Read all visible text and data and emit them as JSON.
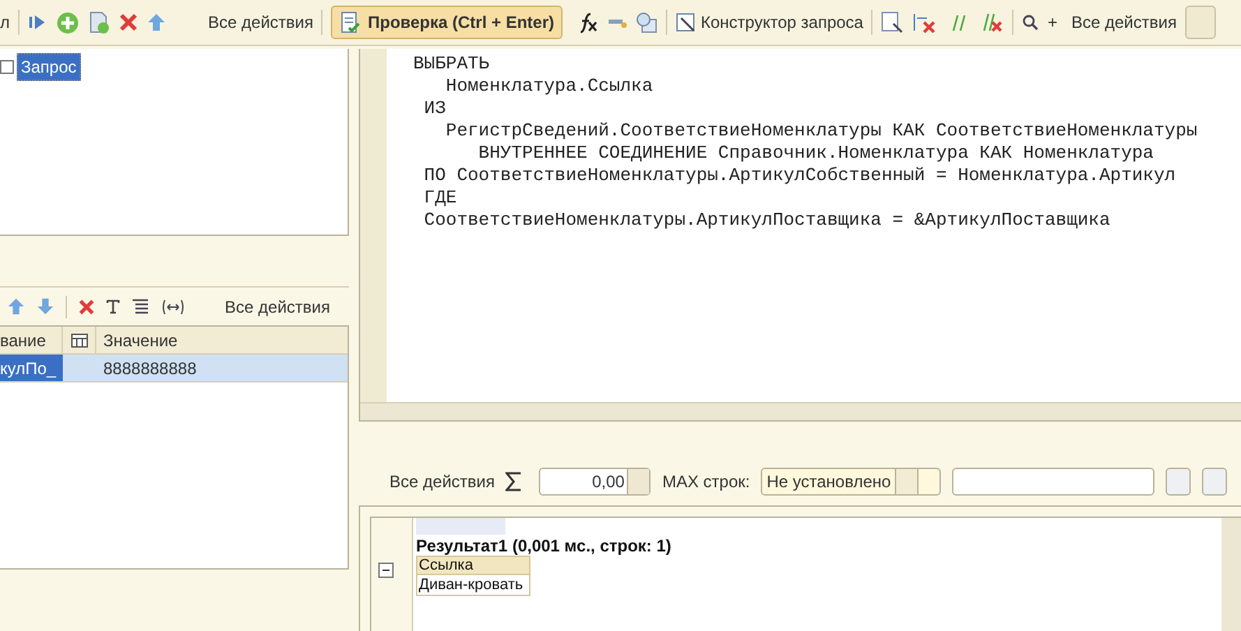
{
  "main_toolbar": {
    "cut_label": "л",
    "actions_menu": "Все действия",
    "check_button": "Проверка (Ctrl + Enter)",
    "constructor_button": "Конструктор запроса",
    "zoom_label": "+",
    "actions_menu_2": "Все действия"
  },
  "query_tree": {
    "items": [
      {
        "label": "Запрос",
        "checked": false,
        "selected": true
      }
    ]
  },
  "parameters": {
    "actions_menu": "Все действия",
    "columns": [
      "вание",
      "Значение"
    ],
    "rows": [
      {
        "name": "кулПо_",
        "value": "8888888888",
        "selected": true
      }
    ]
  },
  "query_text": [
    "ВЫБРАТЬ",
    "   Номенклатура.Ссылка",
    " ИЗ",
    "   РегистрСведений.СоответствиеНоменклатуры КАК СоответствиеНоменклатуры",
    "      ВНУТРЕННЕЕ СОЕДИНЕНИЕ Справочник.Номенклатура КАК Номенклатура",
    " ПО СоответствиеНоменклатуры.АртикулСобственный = Номенклатура.Артикул",
    " ГДЕ",
    " СоответствиеНоменклатуры.АртикулПоставщика = &АртикулПоставщика"
  ],
  "result_toolbar": {
    "actions_menu": "Все действия",
    "sum_value": "0,00",
    "max_rows_label": "MAX строк:",
    "max_rows_value": "Не установлено"
  },
  "result": {
    "title": "Результат1 (0,001 мс., строк: 1)",
    "column": "Ссылка",
    "rows": [
      "Диван-кровать"
    ],
    "expanded": true
  }
}
